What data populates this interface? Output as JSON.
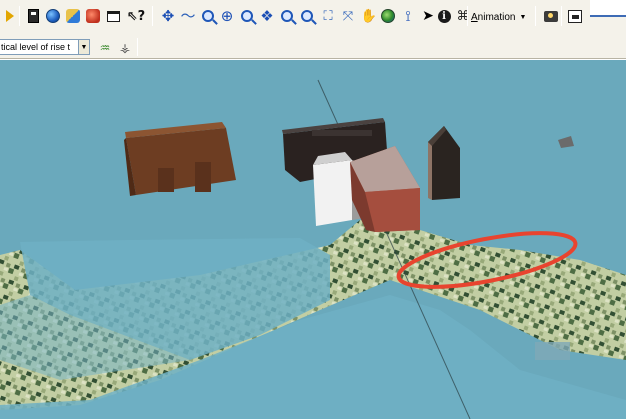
{
  "toolbar_main": {
    "animation_label": "Animation",
    "animation_mnemonic": "A",
    "animation_rest": "nimation",
    "icons": [
      "yellow-arrow-icon",
      "calculator-icon",
      "globe-icon",
      "add-data-icon",
      "red-cube-icon",
      "window-icon",
      "whats-this-help-icon",
      "navigate-icon",
      "fly-icon",
      "zoom-in-icon",
      "zoom-out-icon",
      "target-zoom-icon",
      "full-extent-icon",
      "pan-icon",
      "globe-view-icon",
      "measure-icon",
      "select-pointer-icon",
      "identify-icon",
      "find-icon"
    ]
  },
  "toolbar_secondary": {
    "layer_select_value": "tical level of rise t"
  },
  "colors": {
    "water": "#6aa9bc",
    "land": "#c8cfa4",
    "highlight_ellipse": "#e8442f"
  }
}
